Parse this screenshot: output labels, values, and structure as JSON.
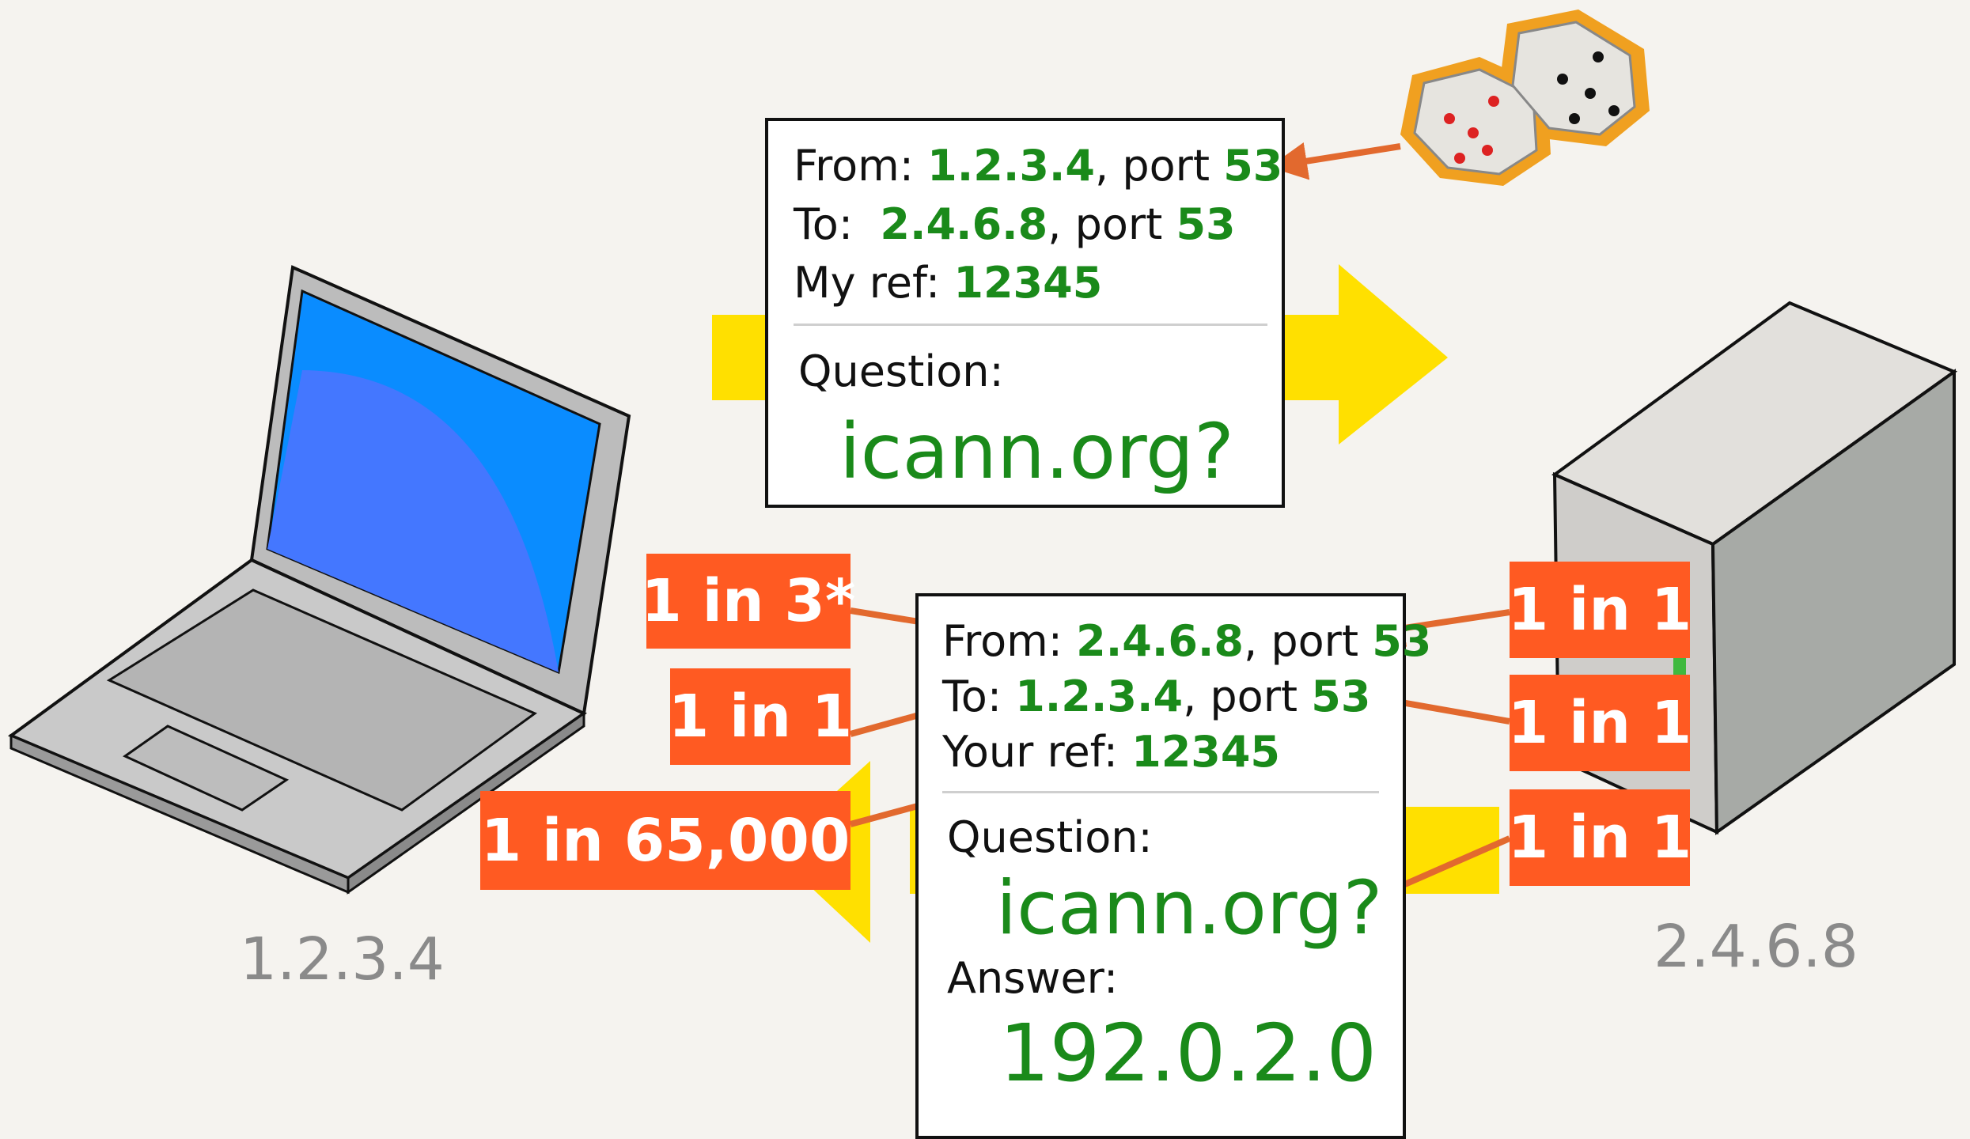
{
  "query": {
    "from_label": "From:",
    "from_ip": "1.2.3.4",
    "from_port_label": ", port",
    "from_port": "53",
    "to_label": "To:",
    "to_ip": "2.4.6.8",
    "to_port_label": ", port",
    "to_port": "53",
    "ref_label": "My ref:",
    "ref": "12345",
    "question_label": "Question:",
    "question": "icann.org?"
  },
  "reply": {
    "from_label": "From:",
    "from_ip": "2.4.6.8",
    "from_port_label": ", port",
    "from_port": "53",
    "to_label": "To:",
    "to_ip": "1.2.3.4",
    "to_port_label": ", port",
    "to_port": "53",
    "ref_label": "Your ref:",
    "ref": "12345",
    "question_label": "Question:",
    "question": "icann.org?",
    "answer_label": "Answer:",
    "answer": "192.0.2.0"
  },
  "client_ip": "1.2.3.4",
  "server_ip": "2.4.6.8",
  "odds": {
    "attacker_from": "1 in 3*",
    "attacker_to": "1 in 1",
    "attacker_ref": "1 in 65,000",
    "server_from": "1 in 1",
    "server_to": "1 in 1",
    "server_question": "1 in 1"
  },
  "colors": {
    "background": "#f5f3ef",
    "value_green": "#1a8a1a",
    "odds_orange": "#ff5a22",
    "arrow_orange": "#e2692e",
    "flow_yellow": "#ffe000",
    "screen_blue": "#0a8cff"
  },
  "icons": [
    "laptop-icon",
    "server-tower-icon",
    "dice-icon"
  ]
}
